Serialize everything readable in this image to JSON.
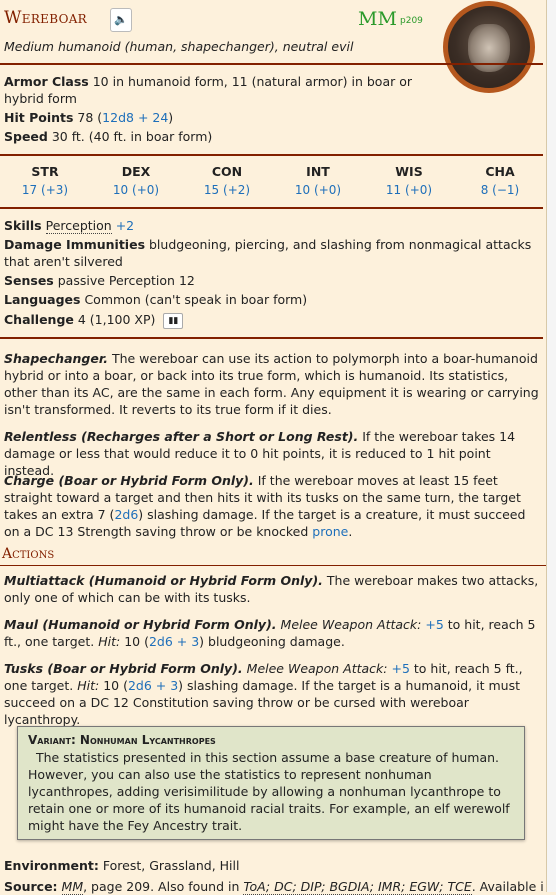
{
  "monster": {
    "name": "Wereboar",
    "source_abbr": "MM",
    "source_page": "p209",
    "type_line": "Medium humanoid (human, shapechanger), neutral evil",
    "armor_class_label": "Armor Class",
    "armor_class_value": "10 in humanoid form, 11 (natural armor) in boar or hybrid form",
    "hit_points_label": "Hit Points",
    "hit_points_value": "78",
    "hit_points_formula": "12d8 + 24",
    "speed_label": "Speed",
    "speed_value": "30 ft. (40 ft. in boar form)"
  },
  "abilities": [
    {
      "label": "STR",
      "value": "17 (+3)"
    },
    {
      "label": "DEX",
      "value": "10 (+0)"
    },
    {
      "label": "CON",
      "value": "15 (+2)"
    },
    {
      "label": "INT",
      "value": "10 (+0)"
    },
    {
      "label": "WIS",
      "value": "11 (+0)"
    },
    {
      "label": "CHA",
      "value": "8 (−1)"
    }
  ],
  "details": {
    "skills_label": "Skills",
    "skills_name": "Perception",
    "skills_bonus": "+2",
    "immunities_label": "Damage Immunities",
    "immunities_value": "bludgeoning, piercing, and slashing from nonmagical attacks that aren't silvered",
    "senses_label": "Senses",
    "senses_value": "passive Perception 12",
    "languages_label": "Languages",
    "languages_value": "Common (can't speak in boar form)",
    "challenge_label": "Challenge",
    "challenge_value": "4 (1,100 XP)"
  },
  "traits": {
    "shapechanger_name": "Shapechanger.",
    "shapechanger_text": "The wereboar can use its action to polymorph into a boar-humanoid hybrid or into a boar, or back into its true form, which is humanoid. Its statistics, other than its AC, are the same in each form. Any equipment it is wearing or carrying isn't transformed. It reverts to its true form if it dies.",
    "relentless_name": "Relentless (Recharges after a Short or Long Rest).",
    "relentless_text": "If the wereboar takes 14 damage or less that would reduce it to 0 hit points, it is reduced to 1 hit point instead.",
    "charge_name": "Charge (Boar or Hybrid Form Only).",
    "charge_text_a": "If the wereboar moves at least 15 feet straight toward a target and then hits it with its tusks on the same turn, the target takes an extra 7 (",
    "charge_dice": "2d6",
    "charge_text_b": ") slashing damage. If the target is a creature, it must succeed on a DC 13 Strength saving throw or be knocked ",
    "charge_condition": "prone",
    "charge_text_c": "."
  },
  "actions": {
    "header": "Actions",
    "multiattack_name": "Multiattack (Humanoid or Hybrid Form Only).",
    "multiattack_text": "The wereboar makes two attacks, only one of which can be with its tusks.",
    "maul_name": "Maul (Humanoid or Hybrid Form Only).",
    "maul_attack_type": "Melee Weapon Attack:",
    "maul_bonus": "+5",
    "maul_text_a": "to hit, reach 5 ft., one target.",
    "maul_hit_label": "Hit:",
    "maul_hit_value": "10 (",
    "maul_dice": "2d6 + 3",
    "maul_text_b": ") bludgeoning damage.",
    "tusks_name": "Tusks (Boar or Hybrid Form Only).",
    "tusks_attack_type": "Melee Weapon Attack:",
    "tusks_bonus": "+5",
    "tusks_text_a": "to hit, reach 5 ft., one target.",
    "tusks_hit_label": "Hit:",
    "tusks_hit_value": "10 (",
    "tusks_dice": "2d6 + 3",
    "tusks_text_b": ") slashing damage. If the target is a humanoid, it must succeed on a DC 12 Constitution saving throw or be cursed with wereboar lycanthropy."
  },
  "variant": {
    "title": "Variant: Nonhuman Lycanthropes",
    "text": "The statistics presented in this section assume a base creature of human. However, you can also use the statistics to represent nonhuman lycanthropes, adding verisimilitude by allowing a nonhuman lycanthrope to retain one or more of its humanoid racial traits. For example, an elf werewolf might have the Fey Ancestry trait."
  },
  "footer": {
    "environment_label": "Environment:",
    "environment_value": "Forest, Grassland, Hill",
    "source_label": "Source:",
    "source_book": "MM",
    "source_text": ", page 209. Also found in ",
    "source_others": "ToA; DC; DIP; BGDIA; IMR; EGW; TCE",
    "source_tail": ". Available in the"
  },
  "icons": {
    "sound": "speaker-icon",
    "challenge": "bar-chart-icon",
    "token": "wereboar-token-image"
  },
  "colors": {
    "accent_red": "#822000",
    "link_blue": "#1e6fba",
    "source_green": "#2b9a2b",
    "parchment": "#fdf1dc",
    "variant_bg": "#e0e5c9"
  }
}
